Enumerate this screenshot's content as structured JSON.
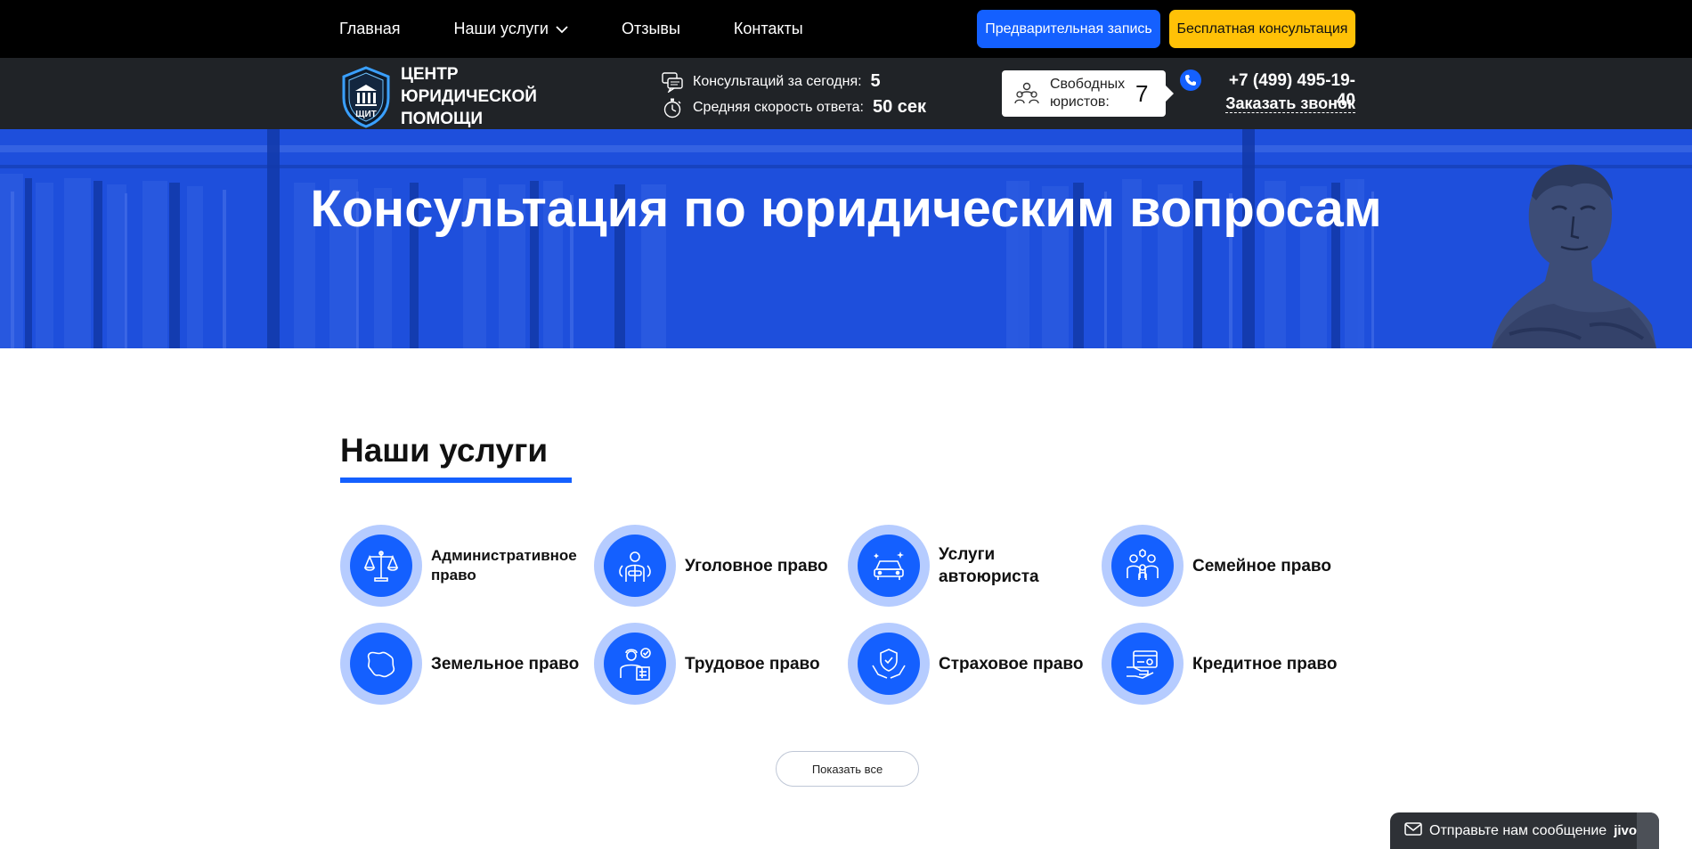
{
  "nav": {
    "items": [
      {
        "label": "Главная"
      },
      {
        "label": "Наши услуги"
      },
      {
        "label": "Отзывы"
      },
      {
        "label": "Контакты"
      }
    ],
    "preorder_button": "Предварительная запись",
    "free_consult_button": "Бесплатная консультация"
  },
  "brand": {
    "shield_text": "ЩИТ",
    "name": "ЦЕНТР ЮРИДИЧЕСКОЙ ПОМОЩИ"
  },
  "stats": {
    "consultations_label": "Консультаций за сегодня:",
    "consultations_value": "5",
    "speed_label": "Средняя скорость ответа:",
    "speed_value": "50 сек"
  },
  "free_lawyers": {
    "label": "Свободных юристов:",
    "value": "7"
  },
  "contact": {
    "phone": "+7 (499) 495-19-40",
    "callback": "Заказать звонок"
  },
  "hero": {
    "title": "Консультация по юридическим вопросам"
  },
  "services": {
    "title": "Наши услуги",
    "items": [
      {
        "name": "Административное право",
        "icon": "scales-icon"
      },
      {
        "name": "Уголовное право",
        "icon": "handcuffs-icon"
      },
      {
        "name": "Услуги автоюриста",
        "icon": "car-icon"
      },
      {
        "name": "Семейное право",
        "icon": "family-icon"
      },
      {
        "name": "Земельное право",
        "icon": "map-icon"
      },
      {
        "name": "Трудовое право",
        "icon": "worker-icon"
      },
      {
        "name": "Страховое право",
        "icon": "shield-hands-icon"
      },
      {
        "name": "Кредитное право",
        "icon": "credit-card-icon"
      }
    ],
    "show_all": "Показать все"
  },
  "chat": {
    "label": "Отправьте нам сообщение",
    "brand": "jivo"
  },
  "colors": {
    "accent_blue": "#1460ff",
    "accent_yellow": "#ffc107",
    "topbar": "#000000",
    "infobar": "#202327",
    "hero": "#1e4fdc"
  }
}
